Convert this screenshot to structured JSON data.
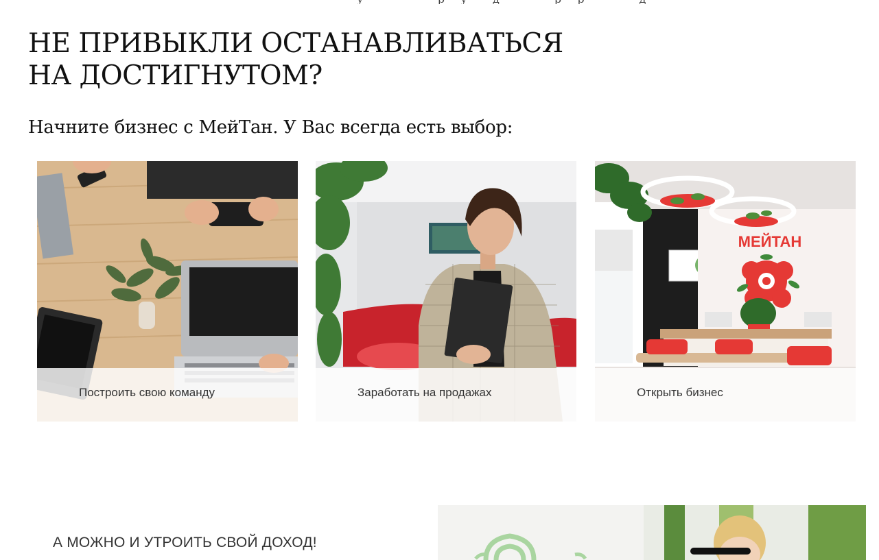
{
  "header": {
    "title_line1": "НЕ ПРИВЫКЛИ ОСТАНАВЛИВАТЬСЯ",
    "title_line2": "НА ДОСТИГНУТОМ?",
    "subtitle": "Начните бизнес с МейТан. У Вас всегда есть выбор:"
  },
  "cards": [
    {
      "label": "Построить свою команду"
    },
    {
      "label": "Заработать на продажах"
    },
    {
      "label": "Открыть бизнес",
      "sign_text": "МЕЙТАН"
    }
  ],
  "section2": {
    "title": "А МОЖНО И УТРОИТЬ СВОЙ ДОХОД!"
  }
}
